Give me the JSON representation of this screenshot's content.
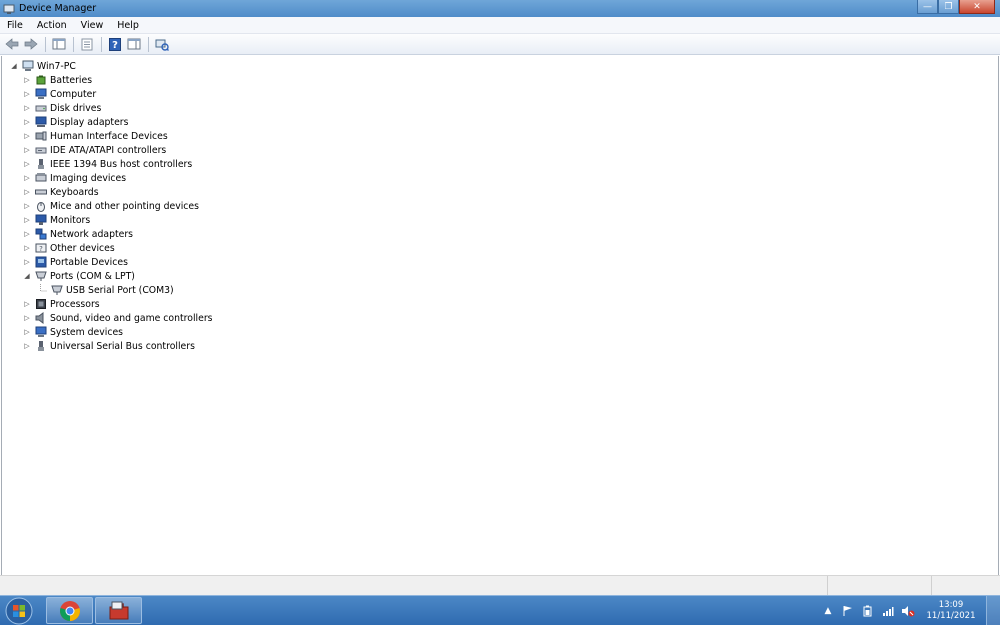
{
  "window": {
    "title": "Device Manager",
    "controls": {
      "minimize": "—",
      "maximize": "❐",
      "close": "✕"
    }
  },
  "menu": {
    "items": [
      "File",
      "Action",
      "View",
      "Help"
    ]
  },
  "toolbar": {
    "buttons": [
      "back-icon",
      "forward-icon",
      "show-hide-console-tree-icon",
      "properties-icon",
      "help-icon",
      "action-pane-icon",
      "scan-hardware-icon"
    ]
  },
  "tree": {
    "root": "Win7-PC",
    "categories": [
      "Batteries",
      "Computer",
      "Disk drives",
      "Display adapters",
      "Human Interface Devices",
      "IDE ATA/ATAPI controllers",
      "IEEE 1394 Bus host controllers",
      "Imaging devices",
      "Keyboards",
      "Mice and other pointing devices",
      "Monitors",
      "Network adapters",
      "Other devices",
      "Portable Devices",
      "Ports (COM & LPT)",
      "Processors",
      "Sound, video and game controllers",
      "System devices",
      "Universal Serial Bus controllers"
    ],
    "expanded_child": "USB Serial Port (COM3)"
  },
  "taskbar": {
    "clock_time": "13:09",
    "clock_date": "11/11/2021",
    "tray_arrow": "▲"
  },
  "colors": {
    "titlebar": "#5b97d1",
    "taskbar": "#3a78bb"
  }
}
